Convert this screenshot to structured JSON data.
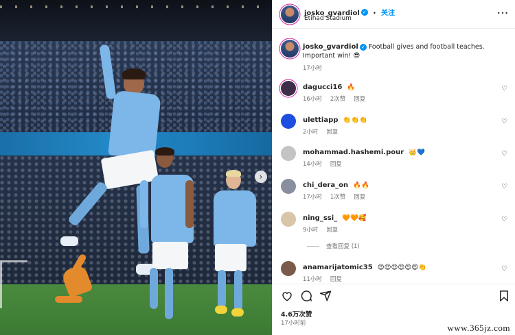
{
  "post": {
    "author": "josko_gvardiol",
    "follow_label": "关注",
    "dot": "•",
    "location": "Etihad Stadium",
    "more_label": "•••",
    "caption": "Football gives and football teaches. Important win! 😎",
    "caption_time": "17小时",
    "verified_mark": "✓"
  },
  "comments": [
    {
      "user": "dagucci16",
      "text": "🔥",
      "time": "16小时",
      "likes": "2次赞",
      "reply": "回复",
      "avatar_color": "#5b3a6e"
    },
    {
      "user": "ulettiapp",
      "text": "👏👏👏",
      "time": "2小时",
      "likes": "",
      "reply": "回复",
      "avatar_color": "#1d4ee0"
    },
    {
      "user": "mohammad.hashemi.pour",
      "text": "👑💙",
      "time": "14小时",
      "likes": "",
      "reply": "回复",
      "avatar_color": "#b9b9b9"
    },
    {
      "user": "chi_dera_on",
      "text": "🔥🔥",
      "time": "17小时",
      "likes": "1次赞",
      "reply": "回复",
      "avatar_color": "#8a8fa0"
    },
    {
      "user": "ning_ssi_",
      "text": "🧡🧡🥰",
      "time": "9小时",
      "likes": "",
      "reply": "回复",
      "avatar_color": "#d9c6a8"
    },
    {
      "user": "anamarijatomic35",
      "text": "😍😍😍😍😍😍👏",
      "time": "11小时",
      "likes": "",
      "reply": "回复",
      "avatar_color": "#7a5a4a"
    }
  ],
  "view_replies": "查看回复 (1)",
  "footer": {
    "likes": "4.6万次赞",
    "time": "17小时前"
  },
  "watermark": "www.365jz.com",
  "icons": {
    "like": "heart-icon",
    "comment": "comment-icon",
    "share": "share-icon",
    "save": "bookmark-icon",
    "next": "chevron-right-icon",
    "more": "more-icon"
  },
  "colors": {
    "accent": "#0095f6",
    "muted": "#737373",
    "text": "#262626",
    "city_blue": "#7db6e8"
  }
}
